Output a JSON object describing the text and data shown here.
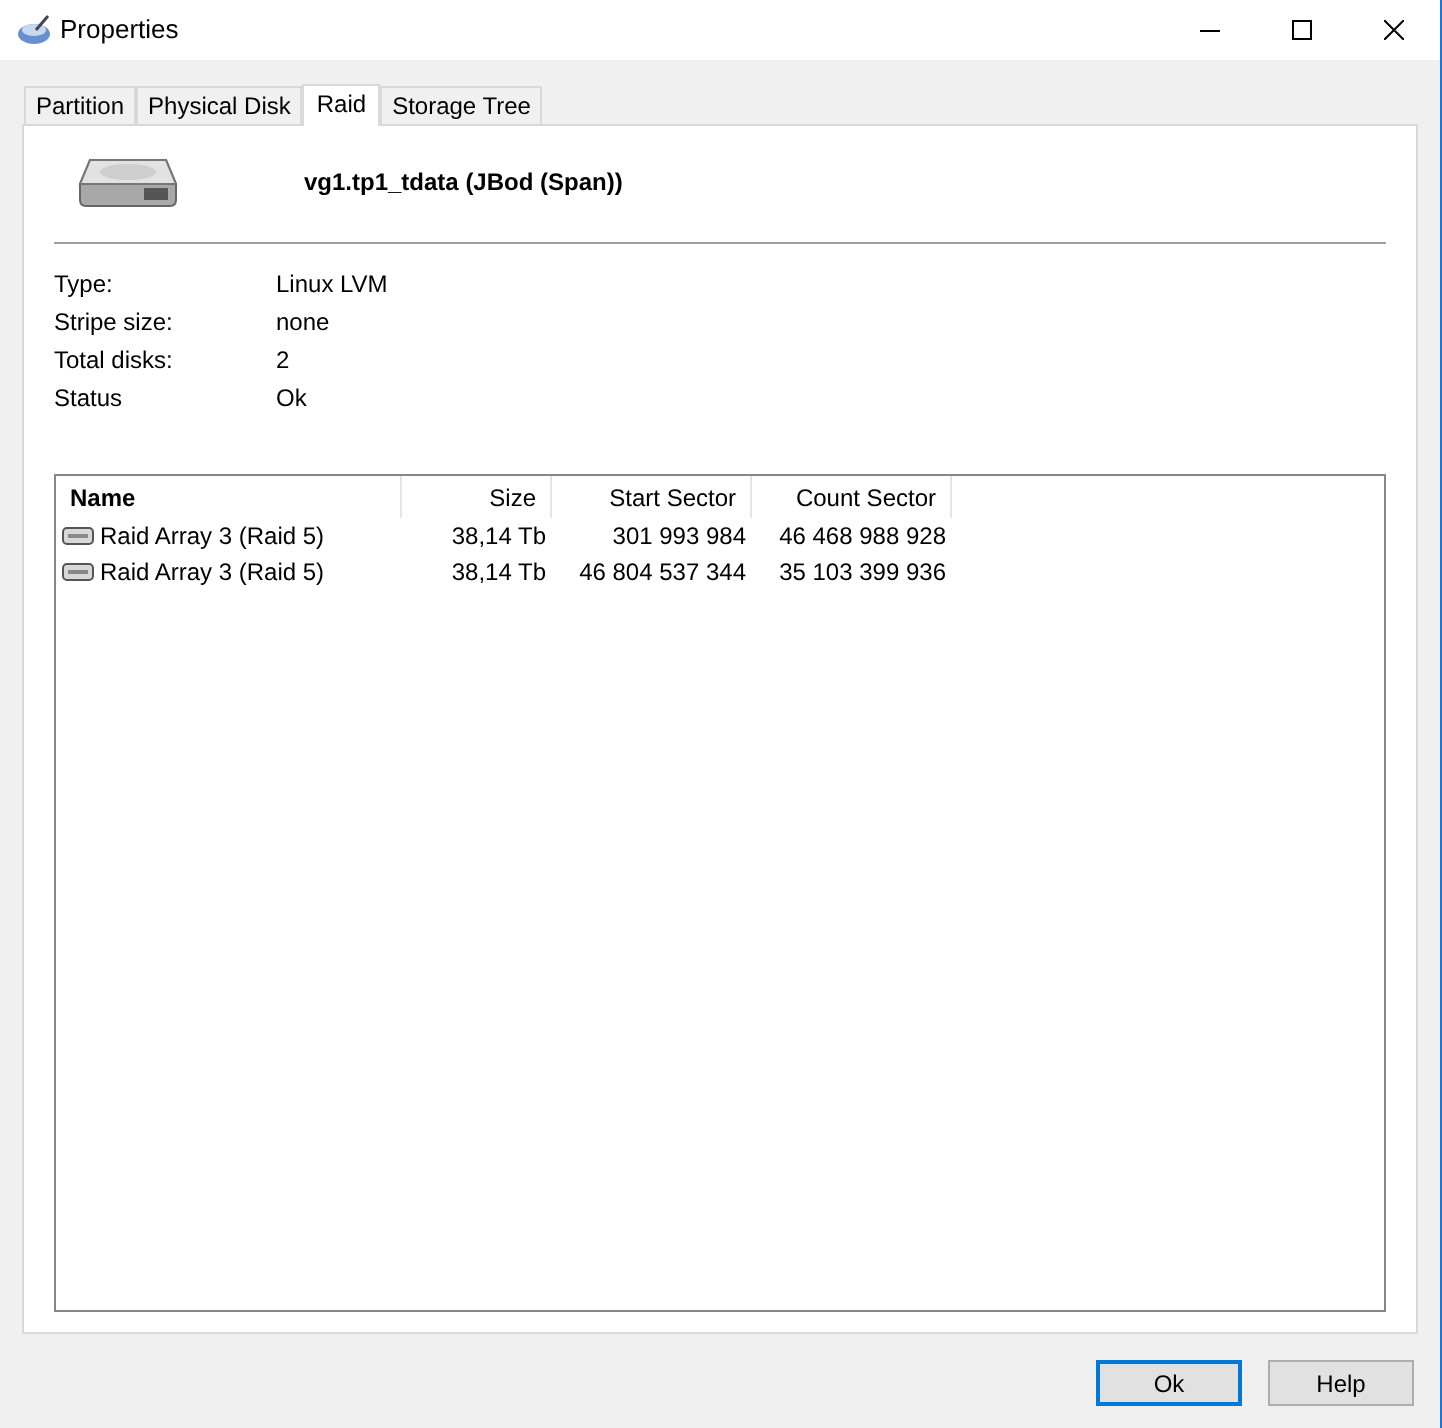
{
  "window": {
    "title": "Properties"
  },
  "tabs": [
    {
      "label": "Partition",
      "selected": false
    },
    {
      "label": "Physical Disk",
      "selected": false
    },
    {
      "label": "Raid",
      "selected": true
    },
    {
      "label": "Storage Tree",
      "selected": false
    }
  ],
  "header": {
    "title": "vg1.tp1_tdata (JBod (Span))"
  },
  "properties": [
    {
      "label": "Type:",
      "value": "Linux LVM"
    },
    {
      "label": "Stripe size:",
      "value": "none"
    },
    {
      "label": "Total disks:",
      "value": "2"
    },
    {
      "label": "Status",
      "value": "Ok"
    }
  ],
  "table": {
    "columns": [
      "Name",
      "Size",
      "Start Sector",
      "Count Sector"
    ],
    "rows": [
      [
        "Raid Array 3 (Raid 5)",
        "38,14 Tb",
        "301 993 984",
        "46 468 988 928"
      ],
      [
        "Raid Array 3 (Raid 5)",
        "38,14 Tb",
        "46 804 537 344",
        "35 103 399 936"
      ]
    ]
  },
  "buttons": [
    {
      "label": "Ok",
      "default": true
    },
    {
      "label": "Help",
      "default": false
    }
  ]
}
